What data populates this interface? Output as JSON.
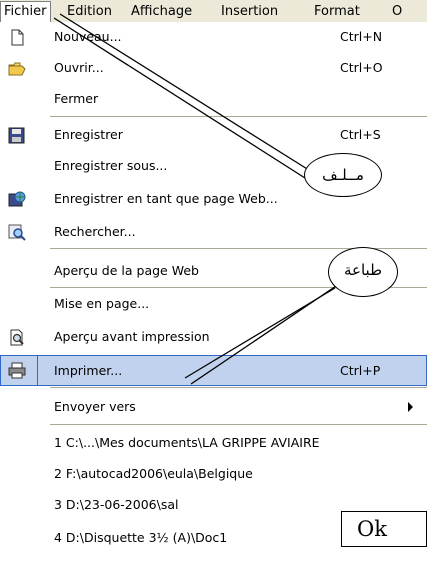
{
  "menubar": {
    "items": [
      {
        "label": "Fichier"
      },
      {
        "label": "Edition"
      },
      {
        "label": "Affichage"
      },
      {
        "label": "Insertion"
      },
      {
        "label": "Format"
      },
      {
        "label": "O"
      }
    ]
  },
  "menu": {
    "items": [
      {
        "label": "Nouveau...",
        "shortcut": "Ctrl+N",
        "icon": "new-document-icon"
      },
      {
        "label": "Ouvrir...",
        "shortcut": "Ctrl+O",
        "icon": "open-folder-icon"
      },
      {
        "label": "Fermer",
        "shortcut": ""
      },
      {
        "label": "Enregistrer",
        "shortcut": "Ctrl+S",
        "icon": "save-disk-icon"
      },
      {
        "label": "Enregistrer sous...",
        "shortcut": ""
      },
      {
        "label": "Enregistrer en tant que page Web...",
        "shortcut": "",
        "icon": "save-web-icon"
      },
      {
        "label": "Rechercher...",
        "shortcut": "",
        "icon": "search-icon"
      },
      {
        "label": "Aperçu de la page Web",
        "shortcut": ""
      },
      {
        "label": "Mise en page...",
        "shortcut": ""
      },
      {
        "label": "Aperçu avant impression",
        "shortcut": "",
        "icon": "print-preview-icon"
      },
      {
        "label": "Imprimer...",
        "shortcut": "Ctrl+P",
        "icon": "printer-icon"
      },
      {
        "label": "Envoyer vers",
        "shortcut": ""
      },
      {
        "label": "1 C:\\...\\Mes documents\\LA GRIPPE AVIAIRE"
      },
      {
        "label": "2 F:\\autocad2006\\eula\\Belgique"
      },
      {
        "label": "3 D:\\23-06-2006\\sal"
      },
      {
        "label": "4 D:\\Disquette 3½ (A)\\Doc1"
      }
    ]
  },
  "annotations": {
    "file_bubble": "مــلـف",
    "print_bubble": "طباعة",
    "ok_box": "Ok"
  },
  "colors": {
    "highlight_bg": "#c1d2ee",
    "highlight_border": "#316ac5",
    "menubar_bg": "#ece9d8"
  }
}
